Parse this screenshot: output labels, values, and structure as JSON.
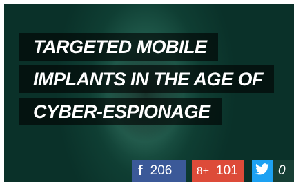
{
  "article": {
    "headline_lines": [
      "TARGETED MOBILE",
      "IMPLANTS IN THE AGE OF",
      "CYBER-ESPIONAGE"
    ]
  },
  "social": {
    "facebook": {
      "icon": "facebook-icon",
      "glyph": "f",
      "count": "206",
      "color": "#3b5998"
    },
    "googleplus": {
      "icon": "googleplus-icon",
      "glyph": "8+",
      "count": "101",
      "color": "#dd4b39"
    },
    "twitter": {
      "icon": "twitter-icon",
      "count": "0",
      "color": "#1da1f2"
    }
  }
}
